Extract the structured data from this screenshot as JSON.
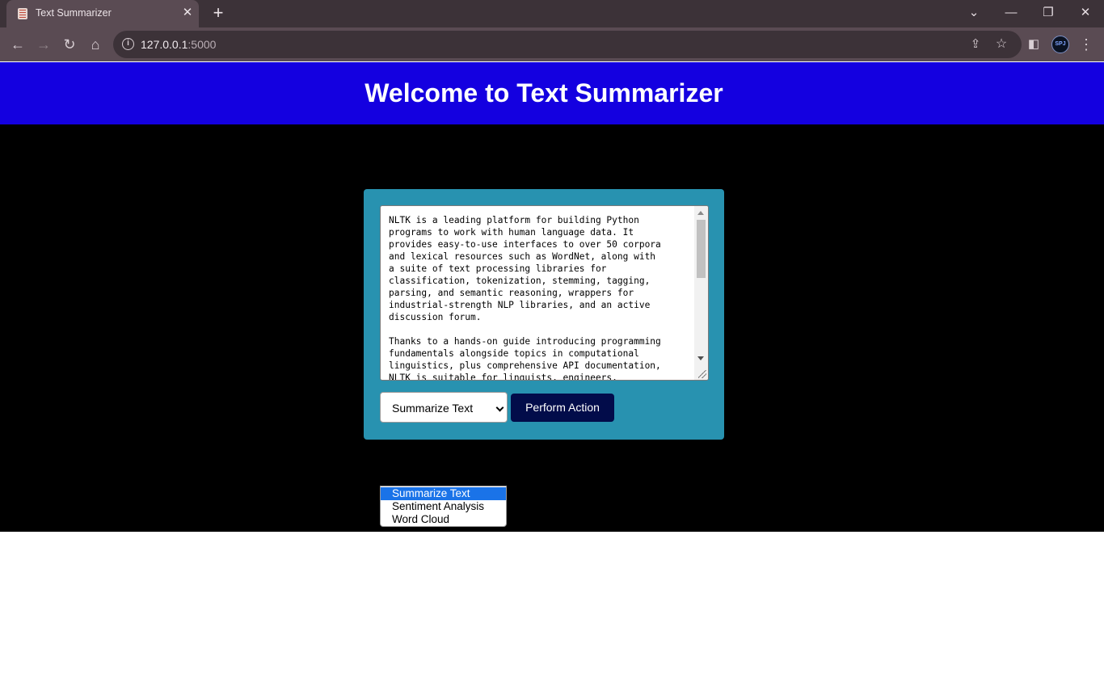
{
  "browser": {
    "tab_title": "Text Summarizer",
    "url_host": "127.0.0.1",
    "url_port": ":5000",
    "avatar": "SPJ"
  },
  "page": {
    "heading": "Welcome to Text Summarizer",
    "input_text": "NLTK is a leading platform for building Python\nprograms to work with human language data. It\nprovides easy-to-use interfaces to over 50 corpora\nand lexical resources such as WordNet, along with\na suite of text processing libraries for\nclassification, tokenization, stemming, tagging,\nparsing, and semantic reasoning, wrappers for\nindustrial-strength NLP libraries, and an active\ndiscussion forum.\n\nThanks to a hands-on guide introducing programming\nfundamentals alongside topics in computational\nlinguistics, plus comprehensive API documentation,\nNLTK is suitable for linguists, engineers,",
    "action_select": {
      "selected": "Summarize Text",
      "options": [
        "Summarize Text",
        "Sentiment Analysis",
        "Word Cloud"
      ]
    },
    "action_button": "Perform Action"
  },
  "colors": {
    "header_bg": "#1400e0",
    "card_bg": "#2892b0",
    "button_bg": "#020c4a",
    "highlight": "#1a73e8"
  }
}
